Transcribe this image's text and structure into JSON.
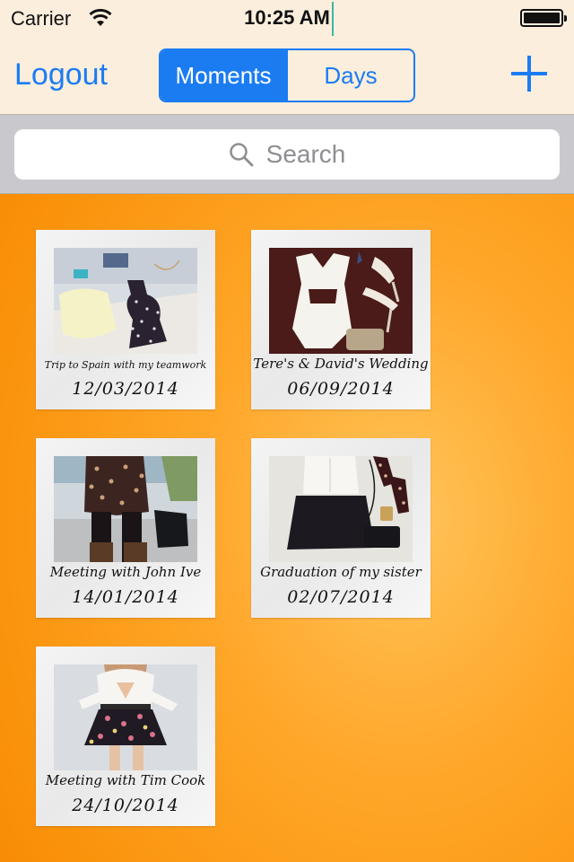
{
  "status_bar": {
    "carrier": "Carrier",
    "time": "10:25 AM",
    "battery_level": 1.0
  },
  "nav": {
    "logout_label": "Logout",
    "segments": [
      {
        "label": "Moments",
        "active": true
      },
      {
        "label": "Days",
        "active": false
      }
    ],
    "add_icon": "plus-icon"
  },
  "search": {
    "placeholder": "Search",
    "icon": "search-icon"
  },
  "moments": [
    {
      "caption": "Trip to Spain with my teamwork",
      "date": "12/03/2014"
    },
    {
      "caption": "Tere's & David's Wedding",
      "date": "06/09/2014"
    },
    {
      "caption": "Meeting with John Ive",
      "date": "14/01/2014"
    },
    {
      "caption": "Graduation of my sister",
      "date": "02/07/2014"
    },
    {
      "caption": "Meeting with Tim Cook",
      "date": "24/10/2014"
    }
  ],
  "colors": {
    "accent": "#1b7cf2",
    "background": "#f98f06",
    "topbar": "#fbeedd"
  }
}
